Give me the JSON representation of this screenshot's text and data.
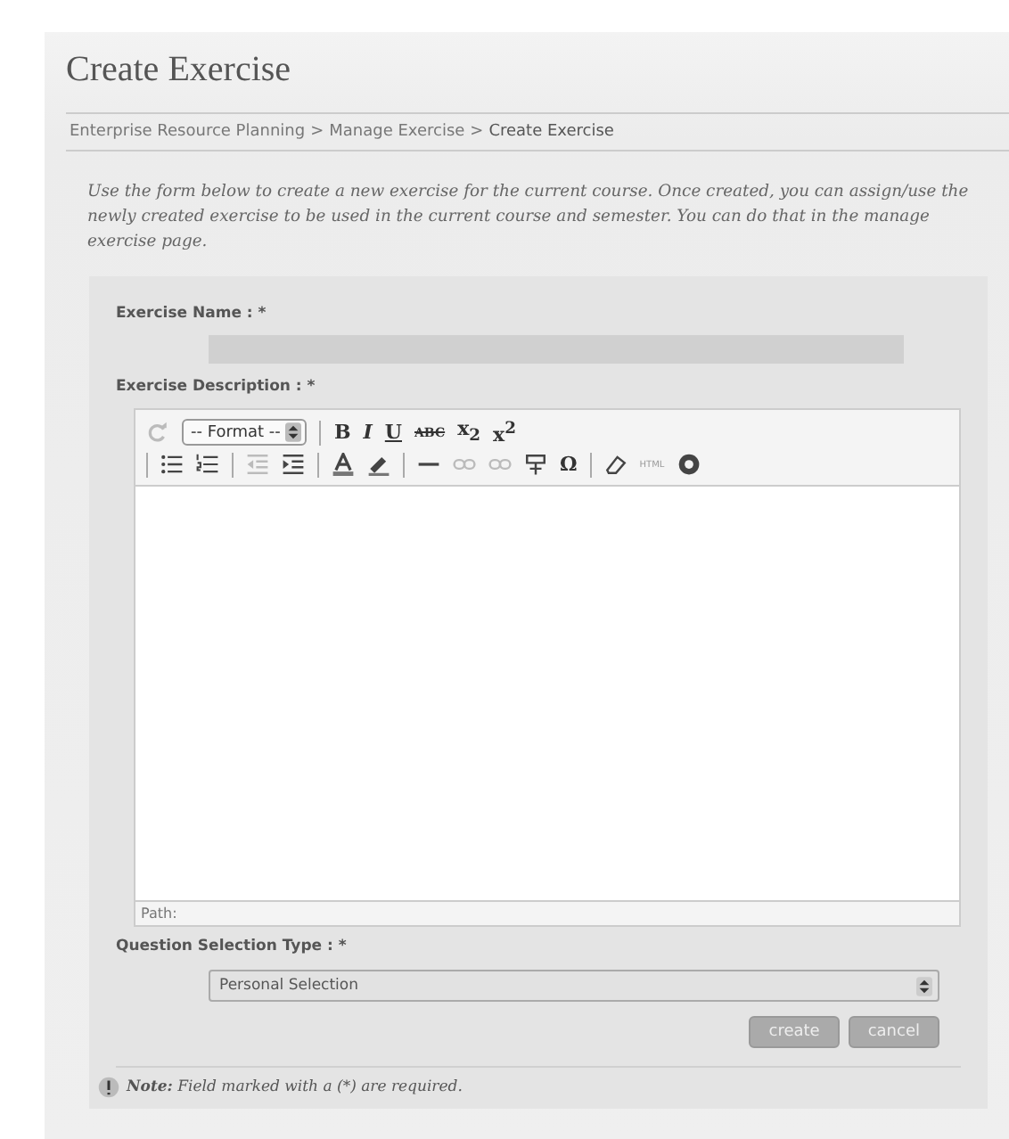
{
  "page_title": "Create Exercise",
  "breadcrumb": [
    "Enterprise Resource Planning",
    "Manage Exercise",
    "Create Exercise"
  ],
  "breadcrumb_separator": ">",
  "intro": "Use the form below to create a new exercise for the current course. Once created, you can assign/use the newly created exercise to be used in the current course and semester. You can do that in the manage exercise page.",
  "form": {
    "name_label": "Exercise Name : *",
    "description_label": "Exercise Description : *",
    "toolbar": [
      [
        {
          "kind": "icon",
          "disabled": true
        },
        {
          "kind": "select",
          "label": "-- Format --"
        },
        {
          "kind": "sep"
        },
        {
          "kind": "bold",
          "label": "B"
        },
        {
          "kind": "italic",
          "label": "I"
        },
        {
          "kind": "underline",
          "label": "U"
        },
        {
          "kind": "strike",
          "label": "ABC"
        },
        {
          "kind": "glyph",
          "label": "x$_{2}$"
        },
        {
          "kind": "glyph",
          "label": "x$^{2}$"
        }
      ],
      [
        {
          "kind": "sep"
        },
        {
          "kind": "icon",
          "disabled": false
        },
        {
          "kind": "icon",
          "disabled": false
        },
        {
          "kind": "sep"
        },
        {
          "kind": "icon",
          "disabled": true
        },
        {
          "kind": "icon",
          "disabled": false
        },
        {
          "kind": "sep"
        },
        {
          "kind": "icon",
          "disabled": false
        },
        {
          "kind": "icon",
          "disabled": false
        },
        {
          "kind": "sep"
        },
        {
          "kind": "icon",
          "disabled": false
        },
        {
          "kind": "icon",
          "disabled": true
        },
        {
          "kind": "icon",
          "disabled": true
        },
        {
          "kind": "icon",
          "disabled": false
        },
        {
          "kind": "glyph",
          "label": "Ω"
        },
        {
          "kind": "sep"
        },
        {
          "kind": "icon",
          "disabled": false
        },
        {
          "kind": "tiny",
          "label": "HTML"
        },
        {
          "kind": "icon",
          "disabled": false
        }
      ]
    ],
    "path_label": "Path:",
    "selection_label": "Question Selection Type : *",
    "selection_value": "Personal Selection",
    "buttons": [
      "create",
      "cancel"
    ]
  },
  "note_label": "Note:",
  "note_text": "Field marked with a (*) are required."
}
